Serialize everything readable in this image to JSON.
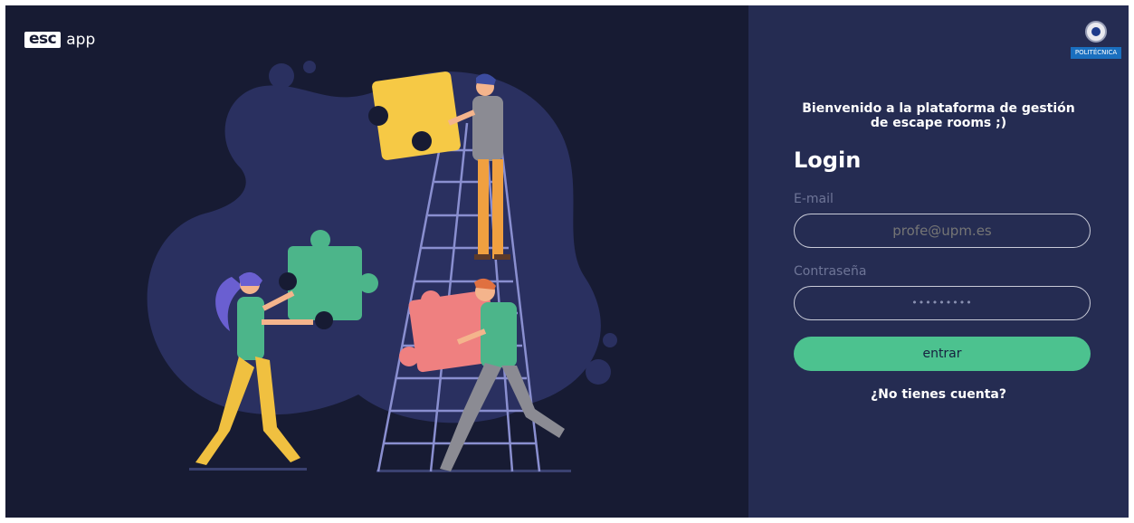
{
  "brand": {
    "logo_box": "esc",
    "logo_text": "app"
  },
  "institution": {
    "label": "POLITÉCNICA"
  },
  "login": {
    "welcome_line1": "Bienvenido a la plataforma de gestión",
    "welcome_line2": "de escape rooms ;)",
    "title": "Login",
    "email_label": "E-mail",
    "email_placeholder": "profe@upm.es",
    "password_label": "Contraseña",
    "password_placeholder": "•••••••••",
    "submit_label": "entrar",
    "signup_link": "¿No tienes cuenta?"
  },
  "colors": {
    "left_bg": "#171b33",
    "right_bg": "#252c52",
    "accent": "#4cc28f",
    "puzzle_yellow": "#f6c945",
    "puzzle_green": "#4cb58a",
    "puzzle_pink": "#ef8080"
  },
  "icons": {
    "upm_seal": "upm-seal-icon"
  }
}
